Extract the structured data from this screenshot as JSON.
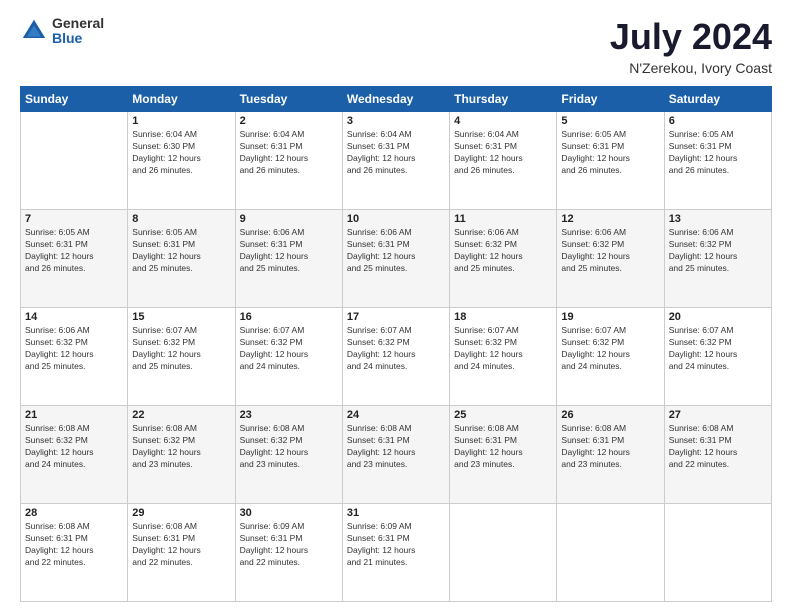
{
  "header": {
    "logo_general": "General",
    "logo_blue": "Blue",
    "title": "July 2024",
    "location": "N'Zerekou, Ivory Coast"
  },
  "days_of_week": [
    "Sunday",
    "Monday",
    "Tuesday",
    "Wednesday",
    "Thursday",
    "Friday",
    "Saturday"
  ],
  "weeks": [
    [
      {
        "day": "",
        "info": ""
      },
      {
        "day": "1",
        "info": "Sunrise: 6:04 AM\nSunset: 6:30 PM\nDaylight: 12 hours\nand 26 minutes."
      },
      {
        "day": "2",
        "info": "Sunrise: 6:04 AM\nSunset: 6:31 PM\nDaylight: 12 hours\nand 26 minutes."
      },
      {
        "day": "3",
        "info": "Sunrise: 6:04 AM\nSunset: 6:31 PM\nDaylight: 12 hours\nand 26 minutes."
      },
      {
        "day": "4",
        "info": "Sunrise: 6:04 AM\nSunset: 6:31 PM\nDaylight: 12 hours\nand 26 minutes."
      },
      {
        "day": "5",
        "info": "Sunrise: 6:05 AM\nSunset: 6:31 PM\nDaylight: 12 hours\nand 26 minutes."
      },
      {
        "day": "6",
        "info": "Sunrise: 6:05 AM\nSunset: 6:31 PM\nDaylight: 12 hours\nand 26 minutes."
      }
    ],
    [
      {
        "day": "7",
        "info": "Sunrise: 6:05 AM\nSunset: 6:31 PM\nDaylight: 12 hours\nand 26 minutes."
      },
      {
        "day": "8",
        "info": "Sunrise: 6:05 AM\nSunset: 6:31 PM\nDaylight: 12 hours\nand 25 minutes."
      },
      {
        "day": "9",
        "info": "Sunrise: 6:06 AM\nSunset: 6:31 PM\nDaylight: 12 hours\nand 25 minutes."
      },
      {
        "day": "10",
        "info": "Sunrise: 6:06 AM\nSunset: 6:31 PM\nDaylight: 12 hours\nand 25 minutes."
      },
      {
        "day": "11",
        "info": "Sunrise: 6:06 AM\nSunset: 6:32 PM\nDaylight: 12 hours\nand 25 minutes."
      },
      {
        "day": "12",
        "info": "Sunrise: 6:06 AM\nSunset: 6:32 PM\nDaylight: 12 hours\nand 25 minutes."
      },
      {
        "day": "13",
        "info": "Sunrise: 6:06 AM\nSunset: 6:32 PM\nDaylight: 12 hours\nand 25 minutes."
      }
    ],
    [
      {
        "day": "14",
        "info": "Sunrise: 6:06 AM\nSunset: 6:32 PM\nDaylight: 12 hours\nand 25 minutes."
      },
      {
        "day": "15",
        "info": "Sunrise: 6:07 AM\nSunset: 6:32 PM\nDaylight: 12 hours\nand 25 minutes."
      },
      {
        "day": "16",
        "info": "Sunrise: 6:07 AM\nSunset: 6:32 PM\nDaylight: 12 hours\nand 24 minutes."
      },
      {
        "day": "17",
        "info": "Sunrise: 6:07 AM\nSunset: 6:32 PM\nDaylight: 12 hours\nand 24 minutes."
      },
      {
        "day": "18",
        "info": "Sunrise: 6:07 AM\nSunset: 6:32 PM\nDaylight: 12 hours\nand 24 minutes."
      },
      {
        "day": "19",
        "info": "Sunrise: 6:07 AM\nSunset: 6:32 PM\nDaylight: 12 hours\nand 24 minutes."
      },
      {
        "day": "20",
        "info": "Sunrise: 6:07 AM\nSunset: 6:32 PM\nDaylight: 12 hours\nand 24 minutes."
      }
    ],
    [
      {
        "day": "21",
        "info": "Sunrise: 6:08 AM\nSunset: 6:32 PM\nDaylight: 12 hours\nand 24 minutes."
      },
      {
        "day": "22",
        "info": "Sunrise: 6:08 AM\nSunset: 6:32 PM\nDaylight: 12 hours\nand 23 minutes."
      },
      {
        "day": "23",
        "info": "Sunrise: 6:08 AM\nSunset: 6:32 PM\nDaylight: 12 hours\nand 23 minutes."
      },
      {
        "day": "24",
        "info": "Sunrise: 6:08 AM\nSunset: 6:31 PM\nDaylight: 12 hours\nand 23 minutes."
      },
      {
        "day": "25",
        "info": "Sunrise: 6:08 AM\nSunset: 6:31 PM\nDaylight: 12 hours\nand 23 minutes."
      },
      {
        "day": "26",
        "info": "Sunrise: 6:08 AM\nSunset: 6:31 PM\nDaylight: 12 hours\nand 23 minutes."
      },
      {
        "day": "27",
        "info": "Sunrise: 6:08 AM\nSunset: 6:31 PM\nDaylight: 12 hours\nand 22 minutes."
      }
    ],
    [
      {
        "day": "28",
        "info": "Sunrise: 6:08 AM\nSunset: 6:31 PM\nDaylight: 12 hours\nand 22 minutes."
      },
      {
        "day": "29",
        "info": "Sunrise: 6:08 AM\nSunset: 6:31 PM\nDaylight: 12 hours\nand 22 minutes."
      },
      {
        "day": "30",
        "info": "Sunrise: 6:09 AM\nSunset: 6:31 PM\nDaylight: 12 hours\nand 22 minutes."
      },
      {
        "day": "31",
        "info": "Sunrise: 6:09 AM\nSunset: 6:31 PM\nDaylight: 12 hours\nand 21 minutes."
      },
      {
        "day": "",
        "info": ""
      },
      {
        "day": "",
        "info": ""
      },
      {
        "day": "",
        "info": ""
      }
    ]
  ]
}
